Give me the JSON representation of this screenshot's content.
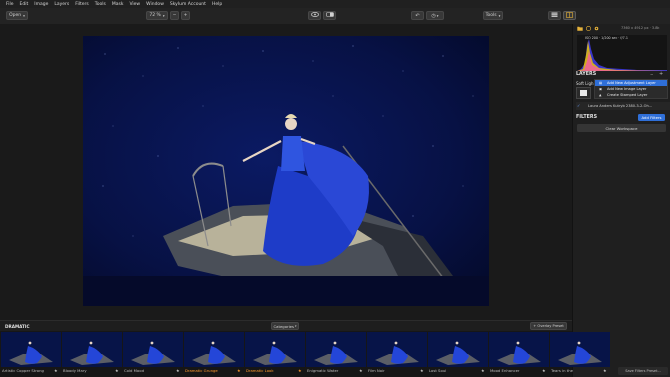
{
  "menu": [
    "File",
    "Edit",
    "Image",
    "Layers",
    "Filters",
    "Tools",
    "Mask",
    "View",
    "Window",
    "Skylum Account",
    "Help"
  ],
  "toolbar": {
    "open_label": "Open",
    "zoom_value": "72 %",
    "zoom_out": "−",
    "zoom_in": "+",
    "tools_label": "Tools"
  },
  "panel": {
    "image_info": "7360 x 4912 px · 3.8k",
    "exif": "ISO 200 · 1/200 sec · f/7.1",
    "layers_title": "LAYERS",
    "soft_light_label": "Soft Ligh",
    "menu_items": [
      "Add New Adjustment Layer",
      "Add New Image Layer",
      "Create Stamped Layer"
    ],
    "layer_name": "Laura Anders Kutryb 2380-3-2-Oh...",
    "filters_title": "FILTERS",
    "add_filters": "Add Filters",
    "clear_workspace": "Clear Workspace",
    "save_preset": "Save Filters Preset..."
  },
  "strip": {
    "category": "DRAMATIC",
    "categories_label": "Categories",
    "overlay_preset": "+ Overlay Preset",
    "presets": [
      {
        "label": "Artistic Copper Strong",
        "selected": false
      },
      {
        "label": "Bloody Mary",
        "selected": false
      },
      {
        "label": "Cold Mood",
        "selected": false
      },
      {
        "label": "Dramatic Grunge",
        "selected": true
      },
      {
        "label": "Dramatic Look",
        "selected": true
      },
      {
        "label": "Enigmatic Water",
        "selected": false
      },
      {
        "label": "Film Noir",
        "selected": false
      },
      {
        "label": "Lost Soul",
        "selected": false
      },
      {
        "label": "Mood Enhancer",
        "selected": false
      },
      {
        "label": "Tears in the",
        "selected": false
      }
    ]
  }
}
